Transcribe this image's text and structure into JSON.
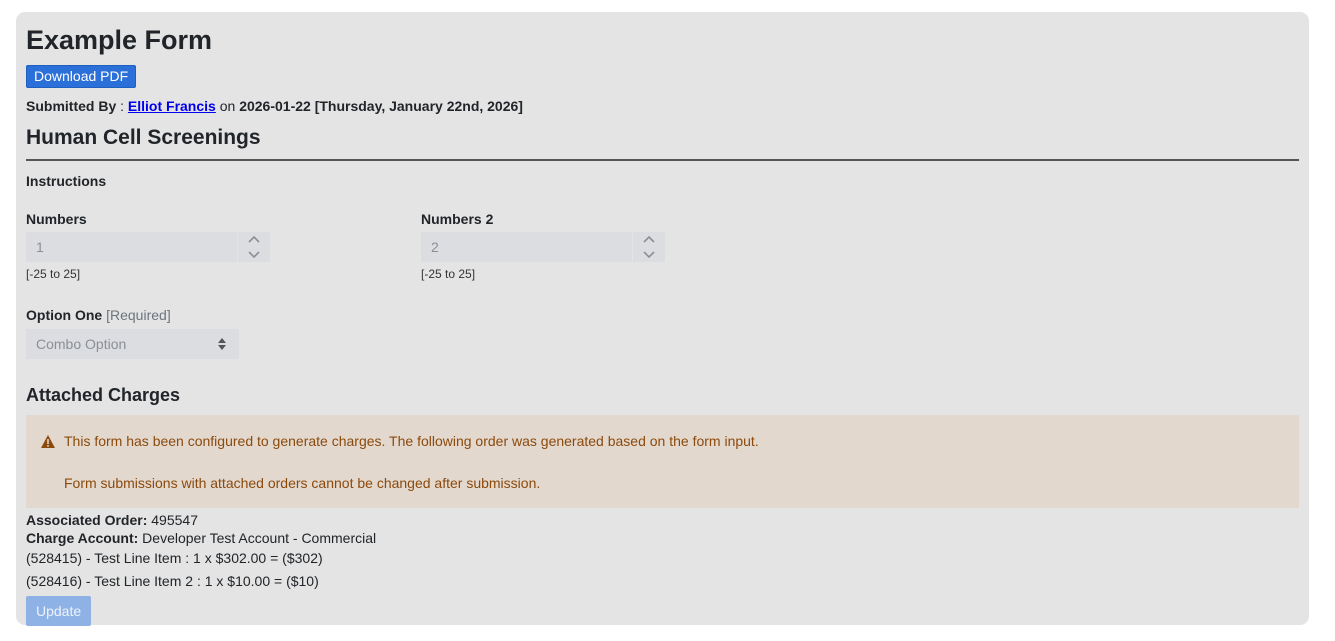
{
  "form": {
    "title": "Example Form",
    "download_pdf_label": "Download PDF",
    "submitted_by_label": "Submitted By",
    "submitted_by_sep": " : ",
    "submitter_name": "Elliot Francis",
    "on_word": " on ",
    "submitted_date": "2026-01-22 [Thursday, January 22nd, 2026]"
  },
  "section": {
    "title": "Human Cell Screenings",
    "instructions_label": "Instructions"
  },
  "fields": {
    "numbers": {
      "label": "Numbers",
      "value": "1",
      "hint": "[-25 to 25]"
    },
    "numbers2": {
      "label": "Numbers 2",
      "value": "2",
      "hint": "[-25 to 25]"
    },
    "option_one": {
      "label": "Option One",
      "required": "[Required]",
      "selected": "Combo Option"
    }
  },
  "charges": {
    "title": "Attached Charges",
    "alert_line1": "This form has been configured to generate charges. The following order was generated based on the form input.",
    "alert_line2": "Form submissions with attached orders cannot be changed after submission.",
    "order_label": "Associated Order:",
    "order_value": "495547",
    "account_label": "Charge Account:",
    "account_value": "Developer Test Account - Commercial",
    "line_items": [
      "(528415) - Test Line Item : 1 x $302.00 = ($302)",
      "(528416) - Test Line Item 2 : 1 x $10.00 = ($10)"
    ],
    "update_label": "Update"
  },
  "colors": {
    "primary_button": "#2b6fd8",
    "disabled_button": "#8fb2e6",
    "alert_bg": "#e3d8ce",
    "alert_text": "#8b4a0c",
    "card_bg": "#e4e4e4"
  },
  "icons": {
    "warning": "warning-triangle-icon",
    "stepper": "chevron-up-down-icon",
    "select": "sort-arrows-icon"
  }
}
